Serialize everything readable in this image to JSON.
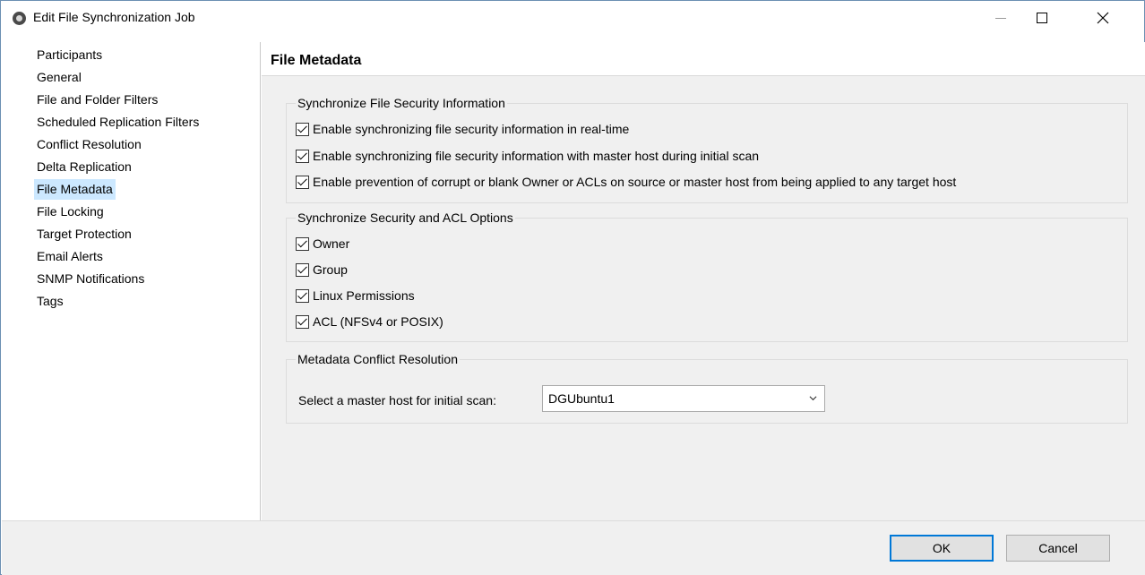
{
  "window": {
    "title": "Edit File Synchronization Job"
  },
  "sidebar": {
    "items": [
      {
        "label": "Participants",
        "selected": false
      },
      {
        "label": "General",
        "selected": false
      },
      {
        "label": "File and Folder Filters",
        "selected": false
      },
      {
        "label": "Scheduled Replication Filters",
        "selected": false
      },
      {
        "label": "Conflict Resolution",
        "selected": false
      },
      {
        "label": "Delta Replication",
        "selected": false
      },
      {
        "label": "File Metadata",
        "selected": true
      },
      {
        "label": "File Locking",
        "selected": false
      },
      {
        "label": "Target Protection",
        "selected": false
      },
      {
        "label": "Email Alerts",
        "selected": false
      },
      {
        "label": "SNMP Notifications",
        "selected": false
      },
      {
        "label": "Tags",
        "selected": false
      }
    ]
  },
  "main": {
    "title": "File Metadata",
    "security_group": {
      "legend": "Synchronize File Security Information",
      "options": [
        {
          "label": "Enable synchronizing file security information in real-time",
          "checked": true
        },
        {
          "label": "Enable synchronizing file security information with master host during initial scan",
          "checked": true
        },
        {
          "label": "Enable prevention of corrupt or blank Owner or ACLs on source or master host from being applied to any target host",
          "checked": true
        }
      ]
    },
    "acl_group": {
      "legend": "Synchronize Security and ACL Options",
      "options": [
        {
          "label": "Owner",
          "checked": true
        },
        {
          "label": "Group",
          "checked": true
        },
        {
          "label": "Linux Permissions",
          "checked": true
        },
        {
          "label": "ACL (NFSv4 or POSIX)",
          "checked": true
        }
      ]
    },
    "conflict_group": {
      "legend": "Metadata Conflict Resolution",
      "select_label": "Select a master host for initial scan:",
      "select_value": "DGUbuntu1"
    }
  },
  "footer": {
    "ok_label": "OK",
    "cancel_label": "Cancel"
  },
  "colors": {
    "selection": "#cce8ff",
    "default_button_border": "#0078d7",
    "panel_background": "#f0f0f0"
  }
}
